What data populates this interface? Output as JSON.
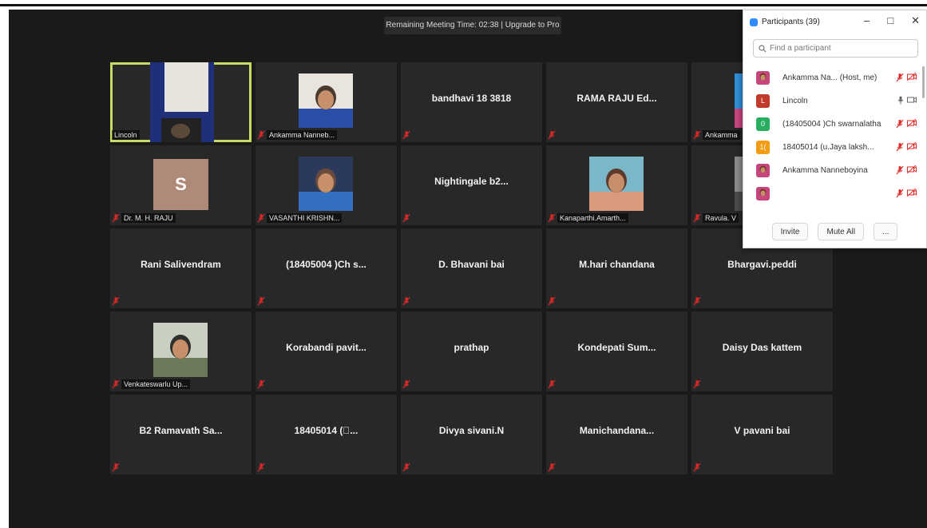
{
  "meeting": {
    "timer_text": "Remaining Meeting Time: 02:38 | Upgrade to Pro"
  },
  "tiles": [
    {
      "kind": "video",
      "label": "Lincoln",
      "active": true,
      "mic_off": false
    },
    {
      "kind": "photo",
      "label": "Ankamma Nanneb...",
      "mic_off": true
    },
    {
      "kind": "name",
      "name": "bandhavi 18 3818",
      "mic_off": true
    },
    {
      "kind": "name",
      "name": "RAMA RAJU Ed...",
      "mic_off": true
    },
    {
      "kind": "photo",
      "label": "Ankamma",
      "mic_off": true
    },
    {
      "kind": "avatar",
      "initial": "S",
      "label": "Dr. M. H. RAJU",
      "mic_off": true
    },
    {
      "kind": "photo",
      "label": "VASANTHI KRISHN...",
      "mic_off": true
    },
    {
      "kind": "name",
      "name": "Nightingale  b2...",
      "mic_off": true
    },
    {
      "kind": "photo",
      "label": "Kanaparthi.Amarth...",
      "mic_off": true
    },
    {
      "kind": "photo",
      "label": "Ravula. V",
      "mic_off": true
    },
    {
      "kind": "name",
      "name": "Rani Salivendram",
      "mic_off": true
    },
    {
      "kind": "name",
      "name": "(18405004 )Ch s...",
      "mic_off": true
    },
    {
      "kind": "name",
      "name": "D. Bhavani bai",
      "mic_off": true
    },
    {
      "kind": "name",
      "name": "M.hari chandana",
      "mic_off": true
    },
    {
      "kind": "name",
      "name": "Bhargavi.peddi",
      "mic_off": true
    },
    {
      "kind": "photo",
      "label": "Venkateswarlu Up...",
      "mic_off": true
    },
    {
      "kind": "name",
      "name": "Korabandi  pavit...",
      "mic_off": true
    },
    {
      "kind": "name",
      "name": "prathap",
      "mic_off": true
    },
    {
      "kind": "name",
      "name": "Kondepati  Sum...",
      "mic_off": true
    },
    {
      "kind": "name",
      "name": "Daisy Das kattem",
      "mic_off": true
    },
    {
      "kind": "name",
      "name": "B2 Ramavath Sa...",
      "mic_off": true
    },
    {
      "kind": "name",
      "name": "18405014 (\u0000...",
      "mic_off": true
    },
    {
      "kind": "name",
      "name": "Divya sivani.N",
      "mic_off": true
    },
    {
      "kind": "name",
      "name": "Manichandana...",
      "mic_off": true
    },
    {
      "kind": "name",
      "name": "V pavani bai",
      "mic_off": true
    }
  ],
  "panel": {
    "title": "Participants (39)",
    "minimize": "–",
    "maximize": "□",
    "close": "✕",
    "search_placeholder": "Find a participant",
    "participants": [
      {
        "avatar": "photo",
        "name": "Ankamma Na...  (Host, me)",
        "mic": "muted",
        "video": "off"
      },
      {
        "avatar": "L",
        "avatar_color": "#c0392b",
        "name": "Lincoln",
        "mic": "on",
        "video": "on"
      },
      {
        "avatar": "0",
        "avatar_color": "#27ae60",
        "name": "(18405004 )Ch swarnalatha",
        "mic": "muted",
        "video": "off"
      },
      {
        "avatar": "1(",
        "avatar_color": "#f39c12",
        "name": "18405014 (u.Jaya laksh...",
        "mic": "muted",
        "video": "off"
      },
      {
        "avatar": "photo",
        "name": "Ankamma Nanneboyina",
        "mic": "muted",
        "video": "off"
      },
      {
        "avatar": "photo",
        "name": "",
        "mic": "muted",
        "video": "off"
      }
    ],
    "buttons": {
      "invite": "Invite",
      "mute_all": "Mute All",
      "more": "..."
    }
  },
  "colors": {
    "active_border": "#c6dc63",
    "muted_red": "#e02828",
    "zoom_blue": "#2d8cff"
  }
}
